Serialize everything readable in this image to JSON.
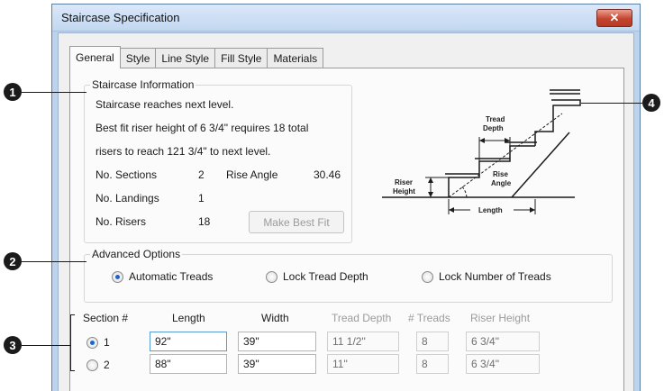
{
  "callouts": [
    "1",
    "2",
    "3",
    "4"
  ],
  "window": {
    "title": "Staircase Specification",
    "close_glyph": "✕"
  },
  "tabs": [
    "General",
    "Style",
    "Line Style",
    "Fill Style",
    "Materials"
  ],
  "info": {
    "legend": "Staircase Information",
    "line1": "Staircase reaches next level.",
    "line2": "Best fit riser height of 6 3/4\" requires 18 total",
    "line3": "risers to reach 121 3/4\" to next level.",
    "sections_label": "No. Sections",
    "sections_value": "2",
    "rise_angle_label": "Rise Angle",
    "rise_angle_value": "30.46",
    "landings_label": "No. Landings",
    "landings_value": "1",
    "risers_label": "No. Risers",
    "risers_value": "18",
    "best_fit_button": "Make Best Fit"
  },
  "diagram": {
    "tread_depth": [
      "Tread",
      "Depth"
    ],
    "riser_height": [
      "Riser",
      "Height"
    ],
    "rise_angle": [
      "Rise",
      "Angle"
    ],
    "length": "Length"
  },
  "advanced": {
    "legend": "Advanced Options",
    "options": [
      "Automatic Treads",
      "Lock Tread Depth",
      "Lock Number of Treads"
    ],
    "selected": "Automatic Treads"
  },
  "sections": {
    "headers": [
      "Section #",
      "Length",
      "Width",
      "Tread Depth",
      "# Treads",
      "Riser Height"
    ],
    "rows": [
      {
        "num": "1",
        "selected": true,
        "length": "92\"",
        "width": "39\"",
        "tread_depth": "11 1/2\"",
        "treads": "8",
        "riser_height": "6 3/4\""
      },
      {
        "num": "2",
        "selected": false,
        "length": "88\"",
        "width": "39\"",
        "tread_depth": "11\"",
        "treads": "8",
        "riser_height": "6 3/4\""
      }
    ]
  }
}
